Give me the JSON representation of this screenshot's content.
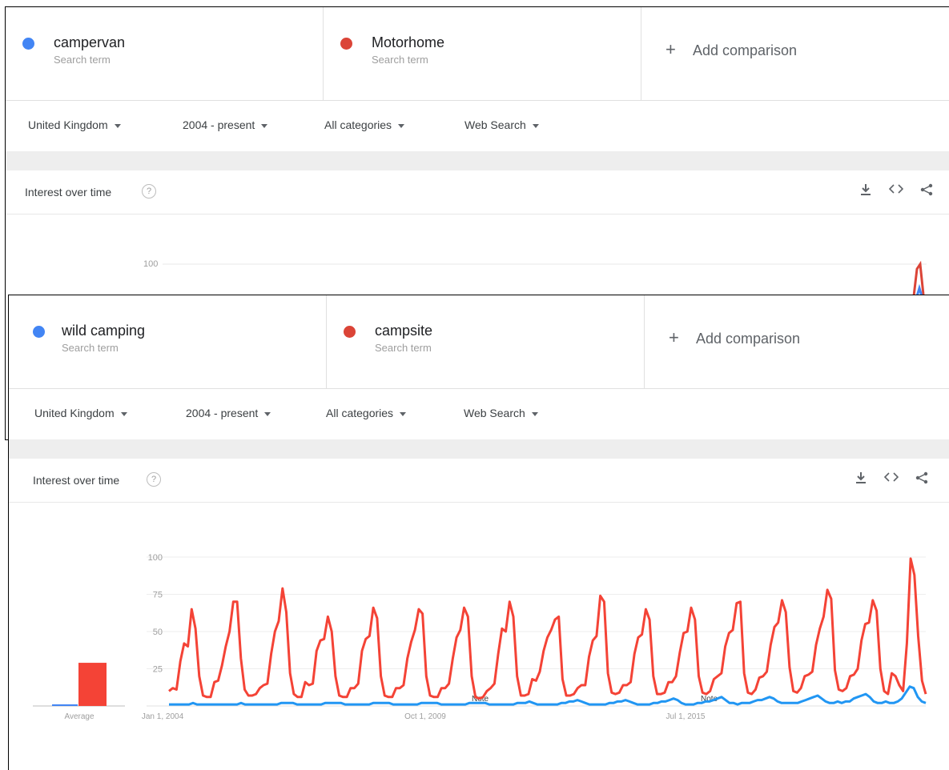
{
  "top_panel": {
    "terms": [
      {
        "name": "campervan",
        "sub": "Search term",
        "color": "#4285f4"
      },
      {
        "name": "Motorhome",
        "sub": "Search term",
        "color": "#db4437"
      }
    ],
    "add_label": "Add comparison",
    "filters": [
      "United Kingdom",
      "2004 - present",
      "All categories",
      "Web Search"
    ],
    "chart_title": "Interest over time",
    "ytick": "100"
  },
  "bottom_panel": {
    "terms": [
      {
        "name": "wild camping",
        "sub": "Search term",
        "color": "#4285f4"
      },
      {
        "name": "campsite",
        "sub": "Search term",
        "color": "#db4437"
      }
    ],
    "add_label": "Add comparison",
    "filters": [
      "United Kingdom",
      "2004 - present",
      "All categories",
      "Web Search"
    ],
    "chart_title": "Interest over time",
    "average_label": "Average",
    "note_labels": [
      "Note",
      "Note"
    ]
  },
  "icons": {
    "help": "?",
    "download": "download-icon",
    "embed": "embed-icon",
    "share": "share-icon"
  },
  "chart_data": {
    "type": "line",
    "title": "Interest over time",
    "xlabel": "",
    "ylabel": "",
    "ylim": [
      0,
      100
    ],
    "yticks": [
      "25",
      "50",
      "75",
      "100"
    ],
    "xtick_labels": [
      "Jan 1, 2004",
      "Oct 1, 2009",
      "Jul 1, 2015"
    ],
    "x_start": "2004-01",
    "x_end": "2018-08",
    "series": [
      {
        "name": "wild camping",
        "color": "#4285f4",
        "average": 1,
        "values": [
          1,
          1,
          1,
          1,
          1,
          1,
          2,
          1,
          1,
          1,
          1,
          1,
          1,
          1,
          1,
          1,
          1,
          1,
          2,
          1,
          1,
          1,
          1,
          1,
          1,
          1,
          1,
          1,
          2,
          2,
          2,
          2,
          1,
          1,
          1,
          1,
          1,
          1,
          1,
          2,
          2,
          2,
          2,
          2,
          1,
          1,
          1,
          1,
          1,
          1,
          1,
          2,
          2,
          2,
          2,
          2,
          1,
          1,
          1,
          1,
          1,
          1,
          1,
          2,
          2,
          2,
          2,
          2,
          1,
          1,
          1,
          1,
          1,
          1,
          1,
          2,
          2,
          2,
          2,
          2,
          1,
          1,
          1,
          1,
          1,
          1,
          1,
          2,
          2,
          2,
          3,
          2,
          1,
          1,
          1,
          1,
          1,
          1,
          2,
          2,
          3,
          3,
          4,
          3,
          2,
          1,
          1,
          1,
          1,
          1,
          2,
          2,
          3,
          3,
          4,
          3,
          2,
          1,
          1,
          1,
          1,
          2,
          2,
          3,
          3,
          4,
          5,
          4,
          2,
          1,
          1,
          1,
          2,
          2,
          3,
          3,
          4,
          5,
          6,
          4,
          2,
          2,
          1,
          2,
          2,
          2,
          3,
          4,
          4,
          5,
          6,
          5,
          3,
          2,
          2,
          2,
          2,
          2,
          3,
          4,
          5,
          6,
          7,
          5,
          3,
          2,
          2,
          3,
          2,
          3,
          3,
          5,
          6,
          7,
          8,
          6,
          3,
          2,
          2,
          3,
          2,
          2,
          3,
          5,
          9,
          13,
          12,
          6,
          3,
          2
        ]
      },
      {
        "name": "campsite",
        "color": "#db4437",
        "average": 29,
        "values": [
          10,
          12,
          11,
          30,
          42,
          40,
          65,
          52,
          20,
          7,
          6,
          6,
          16,
          17,
          27,
          40,
          50,
          70,
          70,
          32,
          11,
          7,
          7,
          8,
          12,
          14,
          15,
          35,
          50,
          57,
          79,
          63,
          22,
          8,
          6,
          6,
          16,
          14,
          15,
          37,
          44,
          45,
          60,
          50,
          20,
          7,
          6,
          6,
          12,
          12,
          15,
          37,
          45,
          47,
          66,
          59,
          20,
          7,
          6,
          6,
          12,
          12,
          14,
          32,
          43,
          51,
          65,
          62,
          20,
          7,
          6,
          6,
          12,
          12,
          15,
          32,
          46,
          51,
          66,
          60,
          20,
          6,
          5,
          6,
          10,
          12,
          15,
          35,
          52,
          50,
          70,
          60,
          20,
          7,
          7,
          8,
          18,
          17,
          23,
          37,
          46,
          51,
          58,
          60,
          18,
          7,
          7,
          8,
          12,
          14,
          14,
          33,
          44,
          47,
          74,
          70,
          22,
          9,
          8,
          9,
          14,
          14,
          16,
          35,
          46,
          48,
          65,
          58,
          20,
          8,
          8,
          9,
          16,
          16,
          20,
          36,
          49,
          50,
          66,
          58,
          20,
          9,
          8,
          10,
          18,
          20,
          22,
          40,
          49,
          51,
          69,
          70,
          22,
          9,
          8,
          11,
          19,
          20,
          23,
          41,
          53,
          56,
          71,
          63,
          26,
          10,
          9,
          12,
          20,
          21,
          23,
          41,
          52,
          60,
          78,
          72,
          24,
          11,
          10,
          12,
          20,
          21,
          25,
          44,
          55,
          56,
          71,
          64,
          25,
          10,
          8,
          22,
          20,
          14,
          10,
          42,
          99,
          88,
          47,
          17,
          8
        ]
      }
    ],
    "annotations": [
      "Note",
      "Note"
    ]
  }
}
